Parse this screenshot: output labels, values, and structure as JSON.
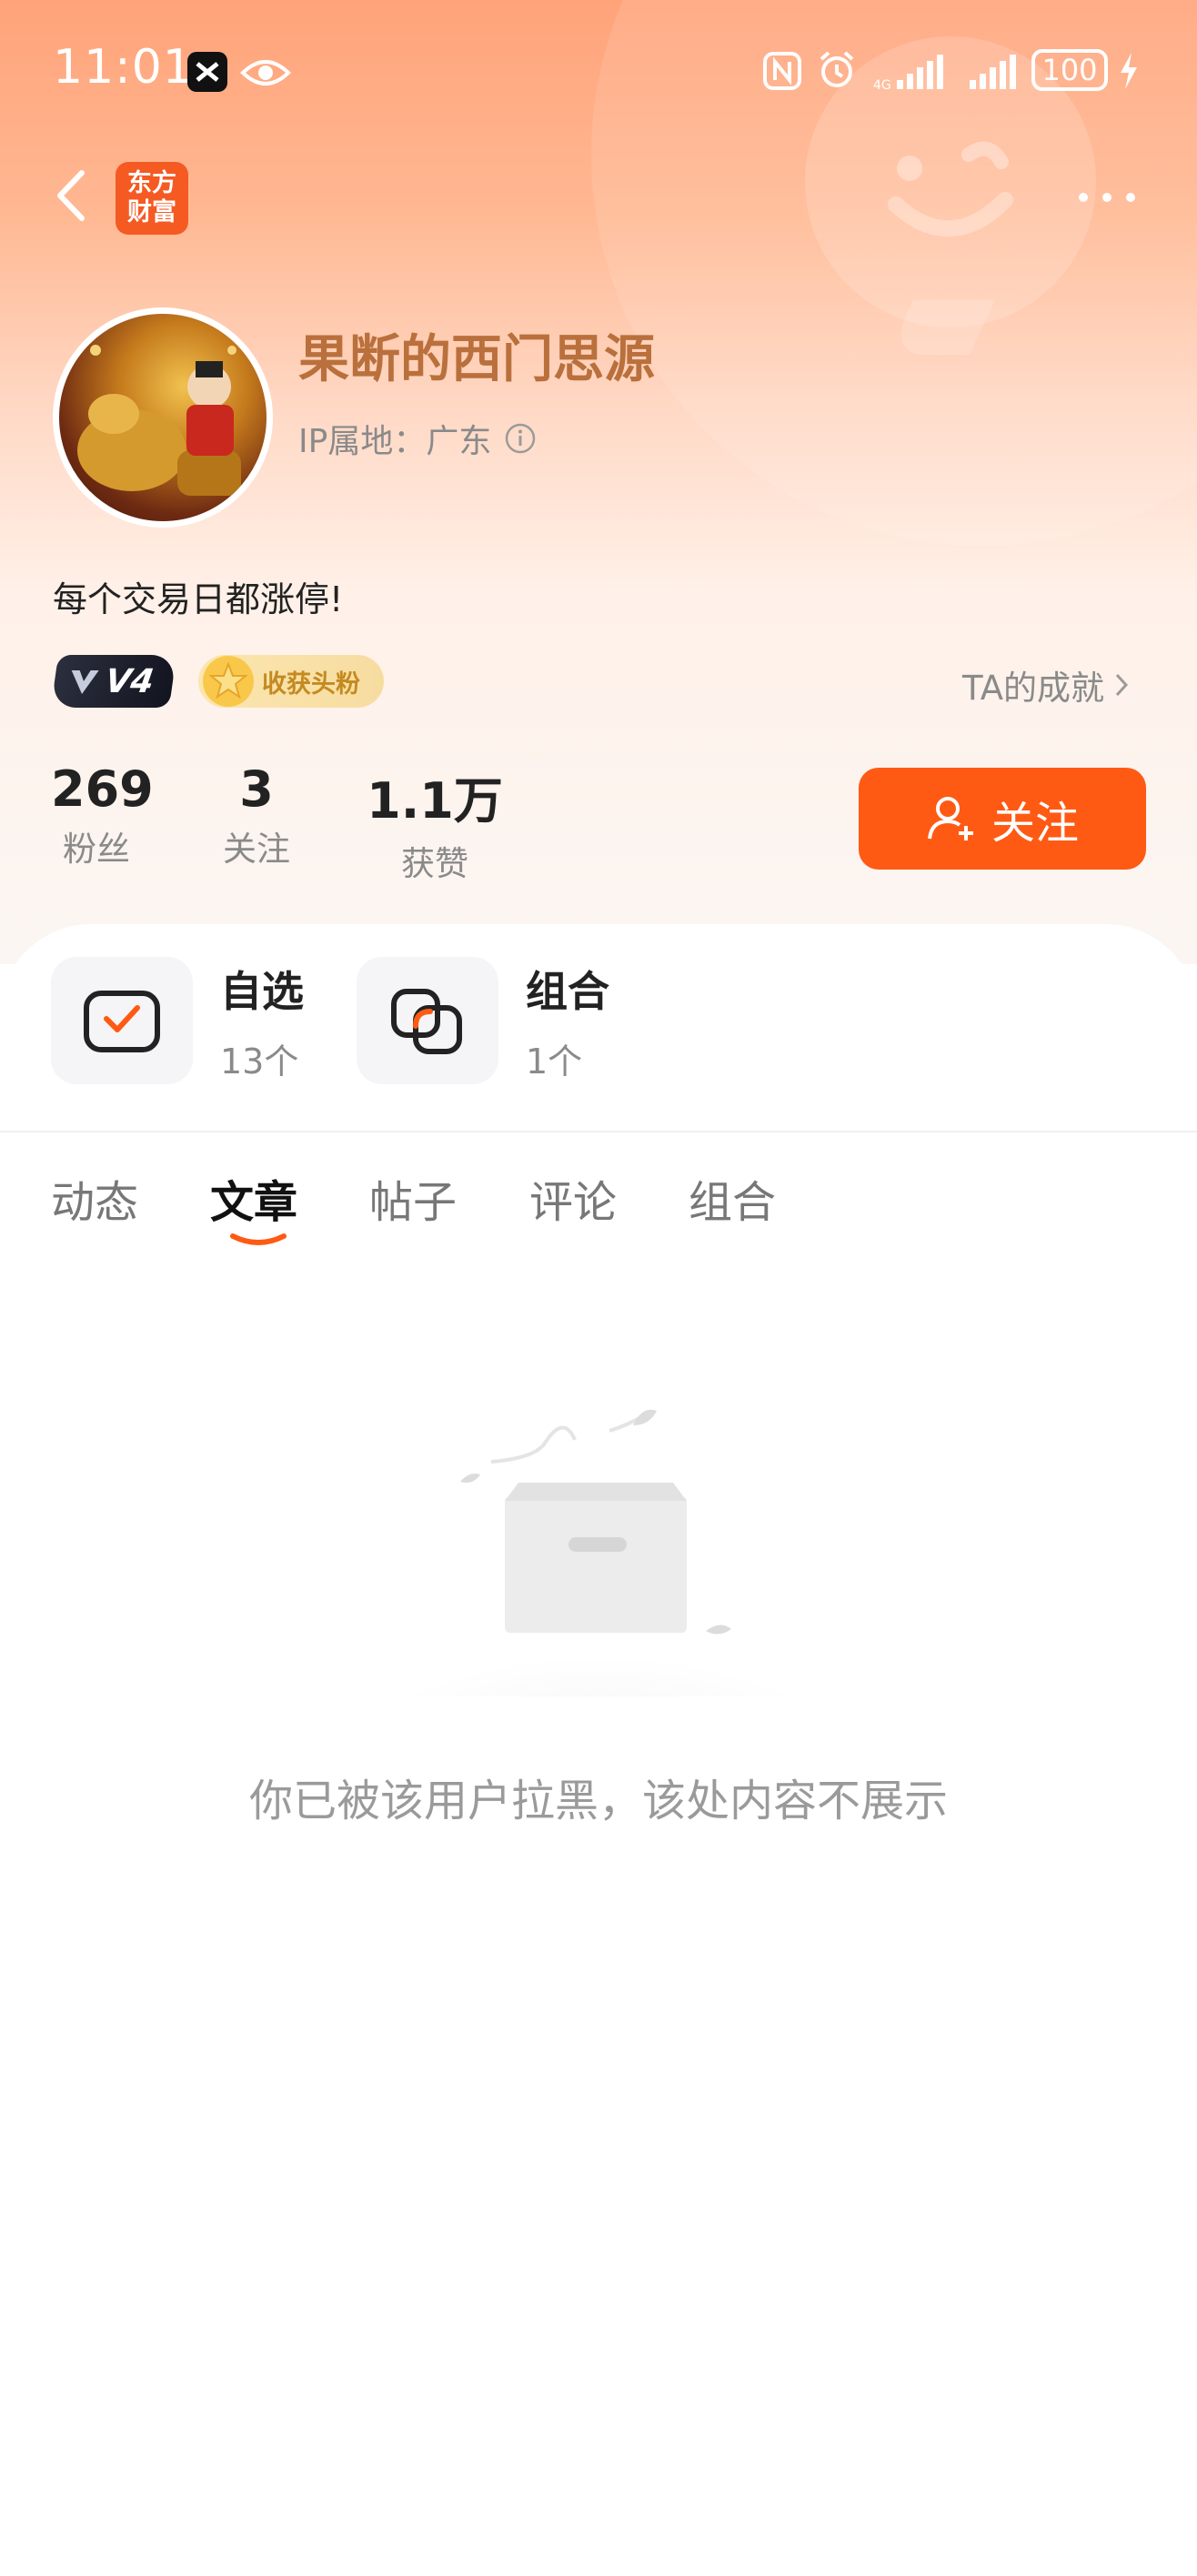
{
  "status_bar": {
    "time": "11:01",
    "battery": "100",
    "icons": [
      "capcut-icon",
      "eye-icon",
      "nfc-icon",
      "alarm-icon",
      "signal-icon",
      "signal-icon",
      "battery-icon",
      "charging-icon"
    ]
  },
  "nav": {
    "logo_line1": "东方",
    "logo_line2": "财富",
    "back_icon": "chevron-left-icon",
    "more_icon": "more-dots-icon"
  },
  "profile": {
    "username": "果断的西门思源",
    "ip_label": "IP属地：广东",
    "bio": "每个交易日都涨停!",
    "level_badge": "V4",
    "fan_badge": "收获头粉",
    "achievement_link": "TA的成就"
  },
  "stats": [
    {
      "value": "269",
      "label": "粉丝"
    },
    {
      "value": "3",
      "label": "关注"
    },
    {
      "value": "1.1万",
      "label": "获赞"
    }
  ],
  "follow_button": "关注",
  "quick_entries": [
    {
      "title": "自选",
      "count": "13个"
    },
    {
      "title": "组合",
      "count": "1个"
    }
  ],
  "tabs": [
    {
      "label": "动态",
      "active": false
    },
    {
      "label": "文章",
      "active": true
    },
    {
      "label": "帖子",
      "active": false
    },
    {
      "label": "评论",
      "active": false
    },
    {
      "label": "组合",
      "active": false
    }
  ],
  "empty_message": "你已被该用户拉黑，该处内容不展示",
  "colors": {
    "accent": "#ff5a14",
    "username": "#b9703c",
    "logo": "#f55a23"
  }
}
